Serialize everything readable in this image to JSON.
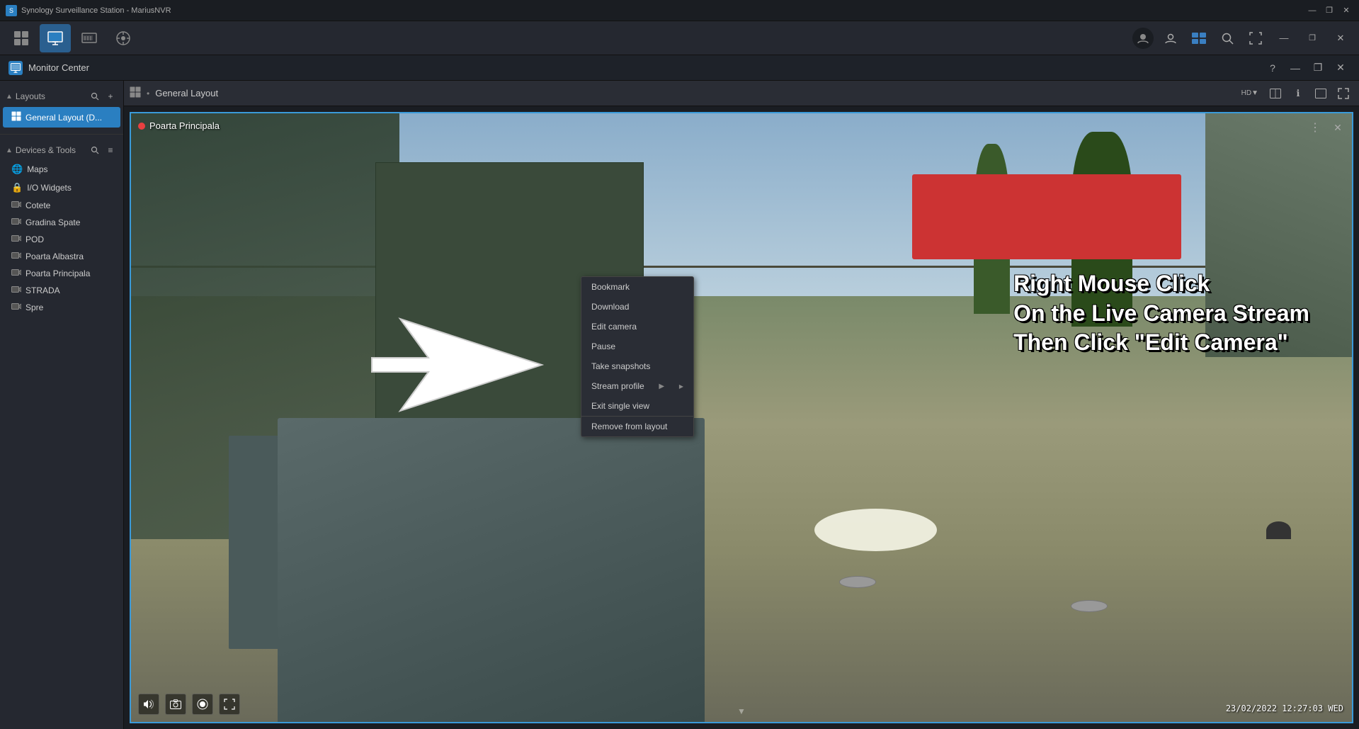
{
  "titlebar": {
    "title": "Synology Surveillance Station - MariusNVR",
    "icon": "▶",
    "minimize_label": "—",
    "restore_label": "❐",
    "close_label": "✕"
  },
  "toolbar": {
    "buttons": [
      {
        "id": "overview",
        "icon": "⊞",
        "label": "Overview",
        "active": false
      },
      {
        "id": "monitor",
        "icon": "📷",
        "label": "Monitor",
        "active": true
      },
      {
        "id": "timeline",
        "icon": "🎞",
        "label": "Timeline",
        "active": false
      },
      {
        "id": "analytics",
        "icon": "🔵",
        "label": "Analytics",
        "active": false
      }
    ],
    "right_buttons": [
      {
        "id": "user",
        "icon": "👤"
      },
      {
        "id": "account",
        "icon": "👤"
      },
      {
        "id": "synology",
        "icon": "🔲"
      },
      {
        "id": "search",
        "icon": "🔍"
      },
      {
        "id": "fullscreen",
        "icon": "⛶"
      },
      {
        "id": "minimize-app",
        "icon": "—"
      },
      {
        "id": "restore-app",
        "icon": "❐"
      },
      {
        "id": "close-app",
        "icon": "✕"
      }
    ]
  },
  "app_header": {
    "icon": "▦",
    "title": "Monitor Center",
    "help_btn": "?",
    "minimize_btn": "—",
    "restore_btn": "❐",
    "close_btn": "✕"
  },
  "sidebar": {
    "layouts_section": {
      "label": "Layouts",
      "collapse_icon": "▲",
      "search_icon": "🔍",
      "add_icon": "+",
      "items": [
        {
          "id": "general-layout",
          "label": "General Layout (D...",
          "active": true,
          "icon": "⊞"
        }
      ]
    },
    "devices_section": {
      "label": "Devices & Tools",
      "collapse_icon": "▲",
      "search_icon": "🔍",
      "menu_icon": "≡",
      "items": [
        {
          "id": "maps",
          "label": "Maps",
          "icon": "🌐",
          "type": "tool"
        },
        {
          "id": "io-widgets",
          "label": "I/O Widgets",
          "icon": "🔒",
          "type": "tool"
        },
        {
          "id": "cotete",
          "label": "Cotete",
          "icon": "cam",
          "type": "camera"
        },
        {
          "id": "gradina-spate",
          "label": "Gradina Spate",
          "icon": "cam",
          "type": "camera"
        },
        {
          "id": "pod",
          "label": "POD",
          "icon": "cam",
          "type": "camera"
        },
        {
          "id": "poarta-albastra",
          "label": "Poarta Albastra",
          "icon": "cam",
          "type": "camera"
        },
        {
          "id": "poarta-principala",
          "label": "Poarta Principala",
          "icon": "cam",
          "type": "camera"
        },
        {
          "id": "strada",
          "label": "STRADA",
          "icon": "cam",
          "type": "camera"
        },
        {
          "id": "spre",
          "label": "Spre",
          "icon": "cam",
          "type": "camera"
        }
      ]
    }
  },
  "layout_header": {
    "grid_icon": "⊞",
    "separator": "•",
    "title": "General Layout",
    "quality_btn": "HD▼",
    "grid_layout_btn": "⊟",
    "info_btn": "ℹ",
    "window_btn": "▭",
    "expand_btn": "⤢"
  },
  "camera_view": {
    "label": "Poarta Principala",
    "status": "recording",
    "timestamp": "23/02/2022  12:27:03  WED",
    "controls": [
      {
        "id": "audio",
        "icon": "🔊"
      },
      {
        "id": "snapshot",
        "icon": "📷"
      },
      {
        "id": "record",
        "icon": "⏺"
      },
      {
        "id": "fullscreen",
        "icon": "⤢"
      }
    ],
    "more_btn": "⋮",
    "expand_btn": "✕"
  },
  "context_menu": {
    "items": [
      {
        "id": "bookmark",
        "label": "Bookmark",
        "has_sub": false
      },
      {
        "id": "download",
        "label": "Download",
        "has_sub": false
      },
      {
        "id": "edit-camera",
        "label": "Edit camera",
        "has_sub": false
      },
      {
        "id": "pause",
        "label": "Pause",
        "has_sub": false
      },
      {
        "id": "take-snapshots",
        "label": "Take snapshots",
        "has_sub": false
      },
      {
        "id": "stream-profile",
        "label": "Stream profile",
        "has_sub": true
      },
      {
        "id": "exit-single-view",
        "label": "Exit single view",
        "has_sub": false
      },
      {
        "id": "remove-from-layout",
        "label": "Remove from layout",
        "has_sub": false
      }
    ]
  },
  "instruction_overlay": {
    "line1": "Right Mouse Click",
    "line2": "On the Live Camera Stream",
    "line3": "Then Click \"Edit Camera\""
  },
  "colors": {
    "accent": "#2a7fc1",
    "active_bg": "#2a5f8f",
    "sidebar_bg": "#252830",
    "titlebar_bg": "#1a1d22",
    "content_bg": "#1a1d22",
    "recording_dot": "#e84040",
    "context_bg": "#2a2d35",
    "border": "#444444"
  }
}
